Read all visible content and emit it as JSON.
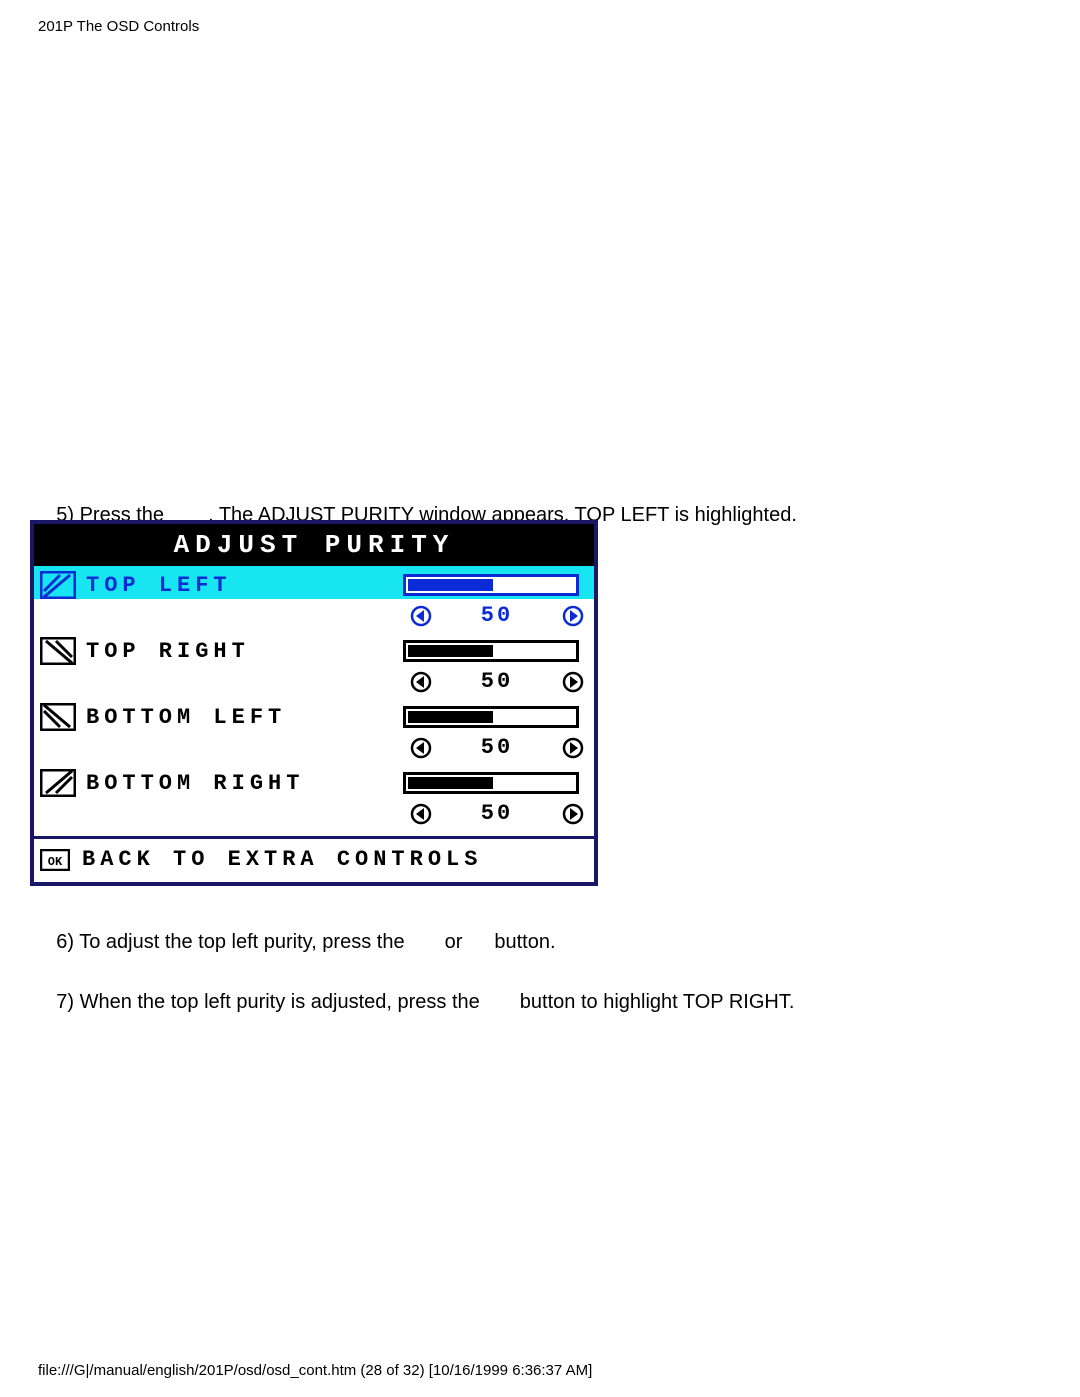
{
  "page_header": "201P The OSD Controls",
  "step5": {
    "prefix": "5) Press the",
    "suffix": ". The ADJUST PURITY window appears. TOP LEFT is highlighted."
  },
  "osd": {
    "title": "ADJUST PURITY",
    "items": [
      {
        "label": "TOP LEFT",
        "value": 50,
        "highlighted": true,
        "icon": "purity-top-left-icon"
      },
      {
        "label": "TOP RIGHT",
        "value": 50,
        "highlighted": false,
        "icon": "purity-top-right-icon"
      },
      {
        "label": "BOTTOM LEFT",
        "value": 50,
        "highlighted": false,
        "icon": "purity-bottom-left-icon"
      },
      {
        "label": "BOTTOM RIGHT",
        "value": 50,
        "highlighted": false,
        "icon": "purity-bottom-right-icon"
      }
    ],
    "footer": "BACK TO EXTRA CONTROLS"
  },
  "step6": {
    "prefix": "6) To adjust the top left purity, press the",
    "mid": "or",
    "suffix": "button."
  },
  "step7": {
    "prefix": "7) When the top left purity is adjusted, press the",
    "suffix": "button to highlight TOP RIGHT."
  },
  "page_footer": "file:///G|/manual/english/201P/osd/osd_cont.htm (28 of 32) [10/16/1999 6:36:37 AM]"
}
